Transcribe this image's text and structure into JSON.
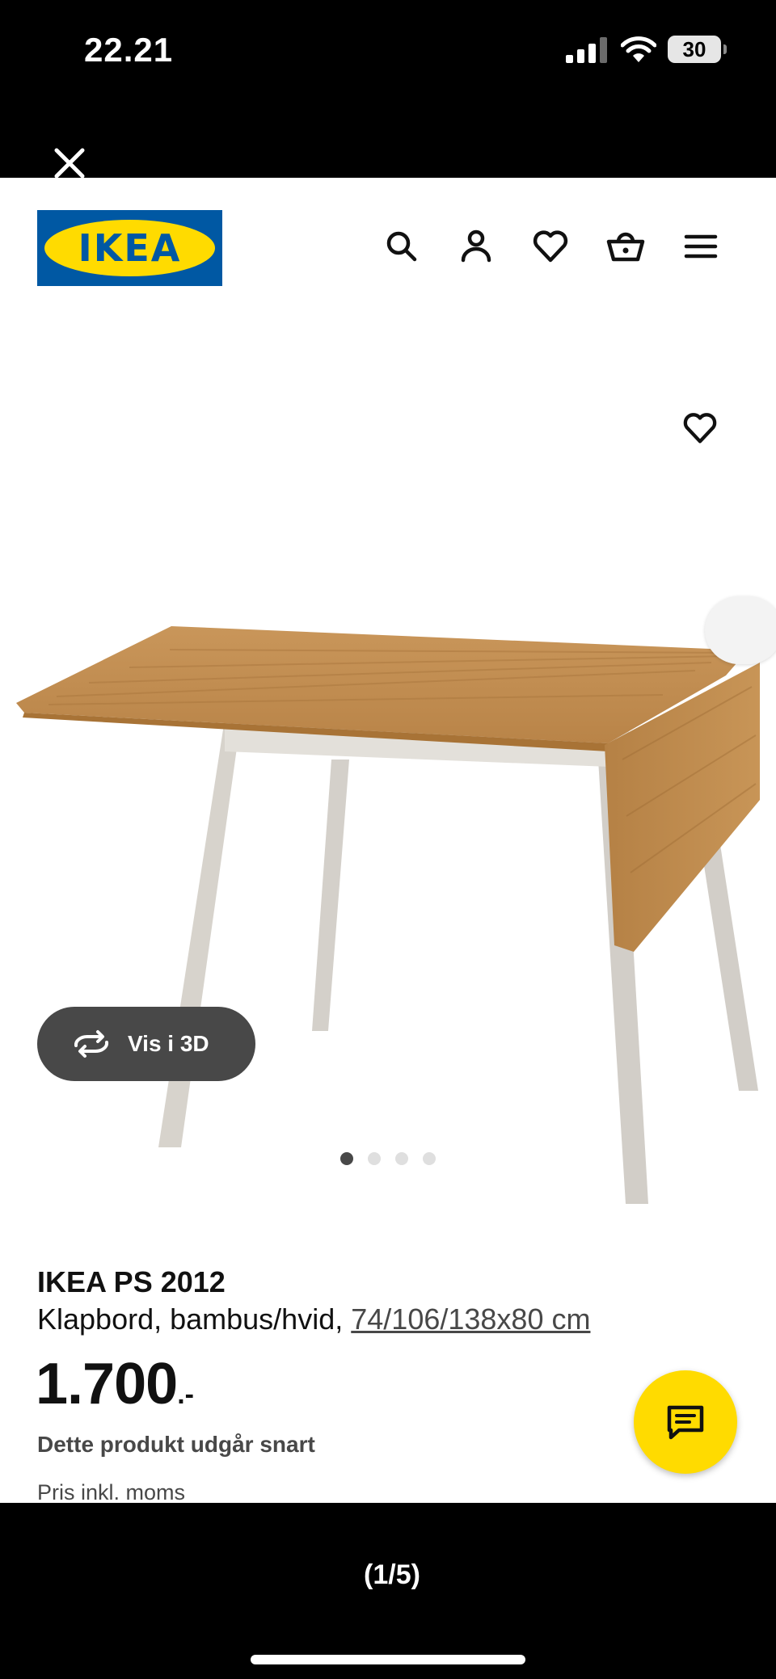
{
  "status_bar": {
    "time": "22.21",
    "battery": "30"
  },
  "header": {
    "logo_text": "IKEA"
  },
  "icons": {
    "close": "close-icon",
    "search": "search-icon",
    "account": "account-icon",
    "favourites": "heart-icon",
    "basket": "basket-icon",
    "menu": "hamburger-menu-icon",
    "view3d": "rotate-icon",
    "chat": "chat-icon"
  },
  "gallery": {
    "view_3d_label": "Vis i 3D",
    "dots": 4,
    "active_index": 0
  },
  "product": {
    "brand": "IKEA PS 2012",
    "description": "Klapbord, bambus/hvid,",
    "dimensions": "74/106/138x80 cm",
    "price_integer": "1.700",
    "price_suffix": ".-",
    "status": "Dette produkt udgår snart",
    "vat_note": "Pris inkl. moms"
  },
  "viewer": {
    "counter": "(1/5)"
  },
  "colors": {
    "ikea_blue": "#0058a3",
    "ikea_yellow": "#ffdb00",
    "dark_grey": "#484848"
  }
}
